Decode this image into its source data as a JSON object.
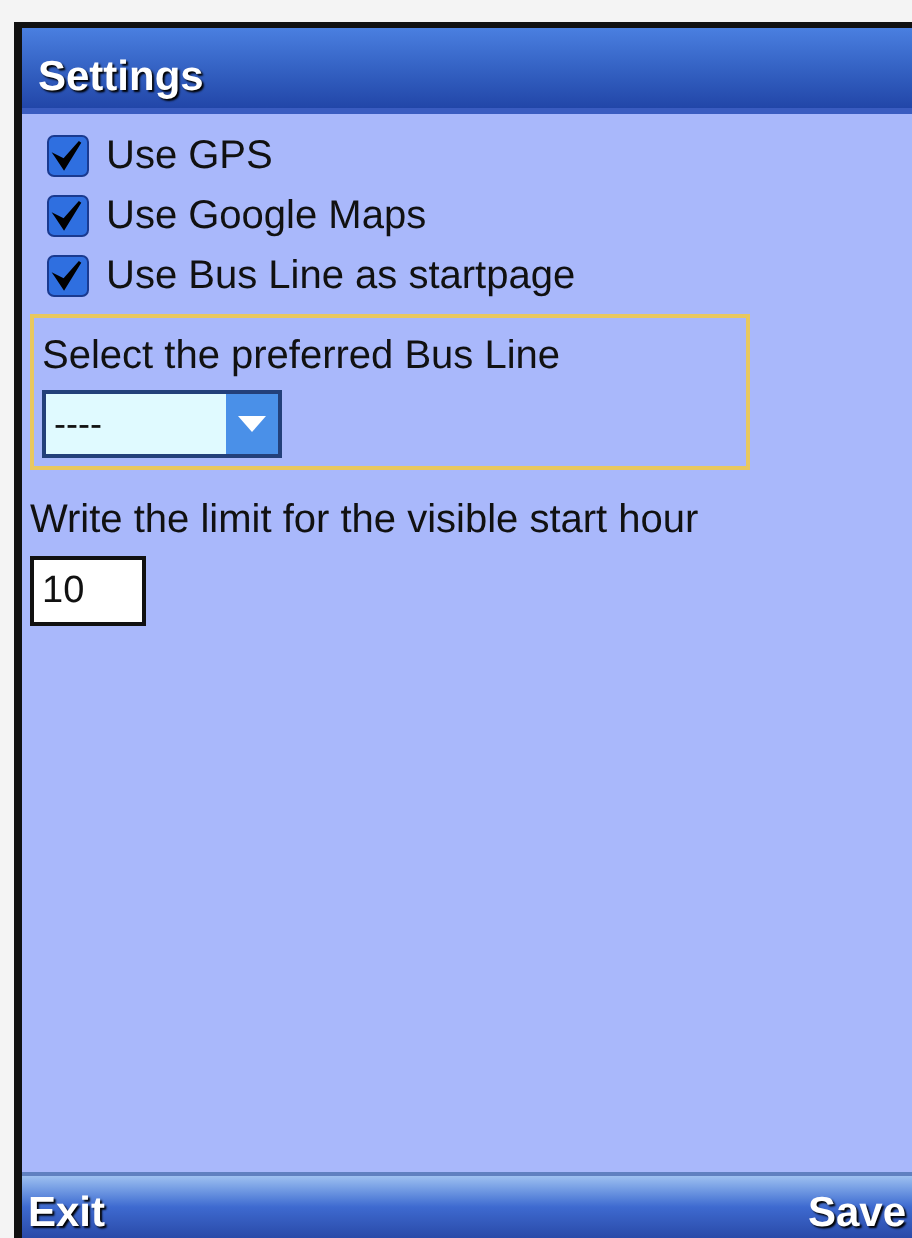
{
  "window": {
    "title": "Settings"
  },
  "options": [
    {
      "label": "Use GPS",
      "checked": true
    },
    {
      "label": "Use Google Maps",
      "checked": true
    },
    {
      "label": "Use Bus Line as startpage",
      "checked": true
    }
  ],
  "bus_line": {
    "label": "Select the preferred Bus Line",
    "value": "----"
  },
  "start_hour": {
    "label": "Write the limit for the visible start hour",
    "value": "10"
  },
  "softkeys": {
    "left": "Exit",
    "right": "Save"
  }
}
